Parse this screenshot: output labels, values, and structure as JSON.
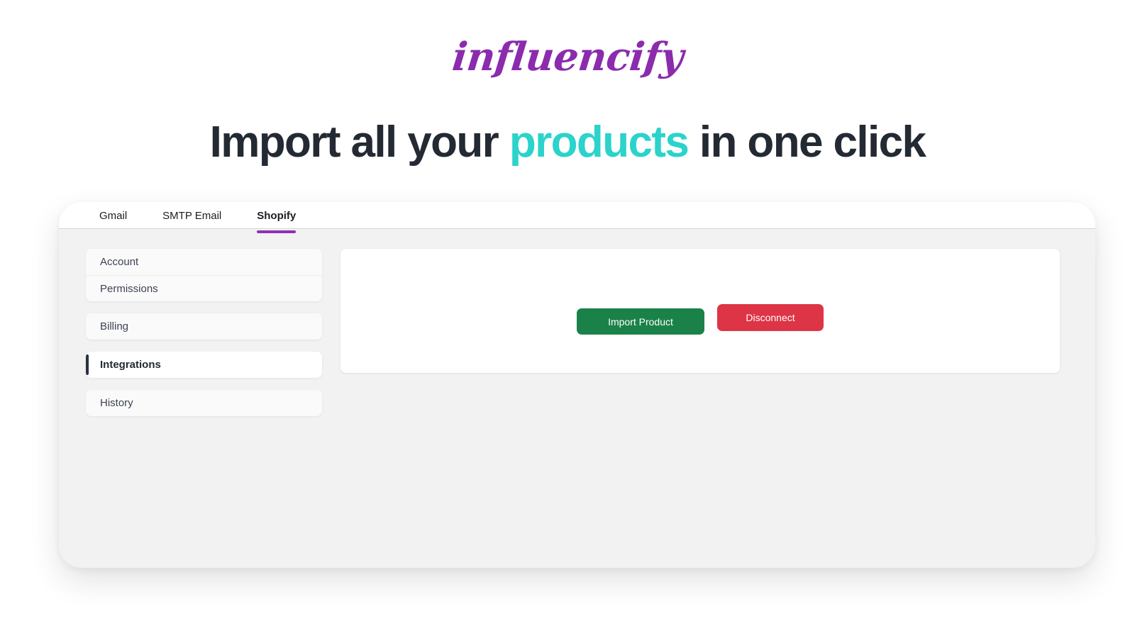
{
  "brand": {
    "logo_text": "influencify",
    "logo_color": "#8B2BAD"
  },
  "headline": {
    "before": "Import all your ",
    "accent": "products",
    "after": " in one click",
    "text_color": "#242A33",
    "accent_color": "#2BD3CB"
  },
  "tabs": [
    {
      "label": "Gmail",
      "active": false
    },
    {
      "label": "SMTP Email",
      "active": false
    },
    {
      "label": "Shopify",
      "active": true
    }
  ],
  "tab_indicator_color": "#8E30B5",
  "sidebar": {
    "groups": [
      {
        "items": [
          {
            "label": "Account",
            "active": false
          },
          {
            "label": "Permissions",
            "active": false
          }
        ]
      },
      {
        "items": [
          {
            "label": "Billing",
            "active": false
          }
        ]
      },
      {
        "items": [
          {
            "label": "Integrations",
            "active": true
          }
        ]
      },
      {
        "items": [
          {
            "label": "History",
            "active": false
          }
        ]
      }
    ]
  },
  "content": {
    "buttons": {
      "import": {
        "label": "Import Product",
        "color": "#1A8249"
      },
      "disconnect": {
        "label": "Disconnect",
        "color": "#DD3546"
      }
    }
  }
}
